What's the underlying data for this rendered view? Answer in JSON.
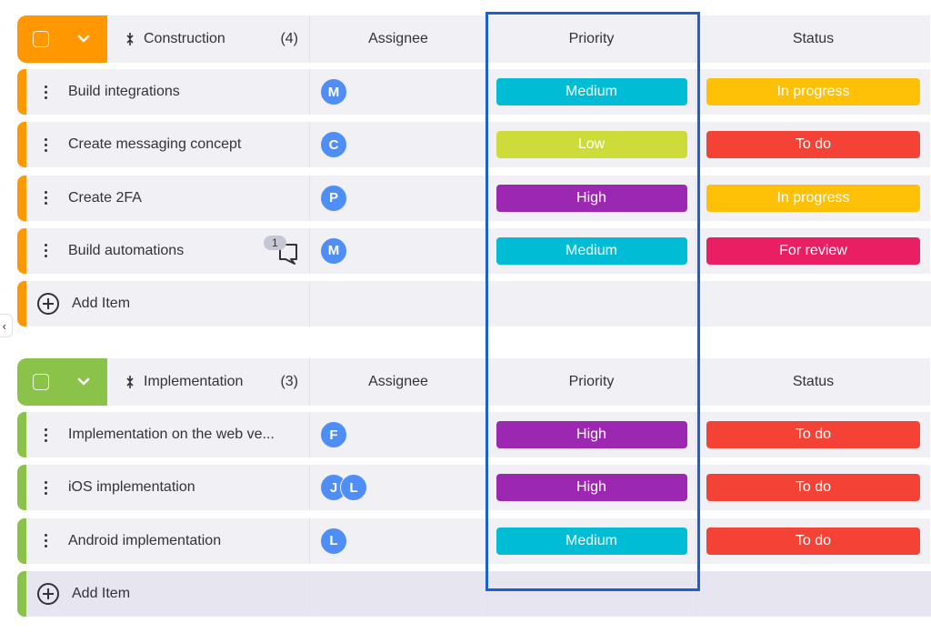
{
  "columns": {
    "assignee": "Assignee",
    "priority": "Priority",
    "status": "Status"
  },
  "colors": {
    "construction": "#ff9800",
    "implementation": "#8bc34a",
    "priority": {
      "Low": "#cddc39",
      "Medium": "#00bcd4",
      "High": "#9c27b0"
    },
    "status": {
      "In progress": "#ffc107",
      "To do": "#f44336",
      "For review": "#e91e63"
    },
    "highlight": "#1a5fd6",
    "avatar": "#4f8ef7"
  },
  "groups": [
    {
      "name": "Construction",
      "count": "(4)",
      "items": [
        {
          "name": "Build integrations",
          "assignees": [
            "M"
          ],
          "priority": "Medium",
          "status": "In progress"
        },
        {
          "name": "Create messaging concept",
          "assignees": [
            "C"
          ],
          "priority": "Low",
          "status": "To do"
        },
        {
          "name": "Create 2FA",
          "assignees": [
            "P"
          ],
          "priority": "High",
          "status": "In progress"
        },
        {
          "name": "Build automations",
          "assignees": [
            "M"
          ],
          "priority": "Medium",
          "status": "For review",
          "comments": "1"
        }
      ],
      "add_label": "Add Item"
    },
    {
      "name": "Implementation",
      "count": "(3)",
      "items": [
        {
          "name": "Implementation on the web ve...",
          "assignees": [
            "F"
          ],
          "priority": "High",
          "status": "To do"
        },
        {
          "name": "iOS implementation",
          "assignees": [
            "J",
            "L"
          ],
          "priority": "High",
          "status": "To do"
        },
        {
          "name": "Android implementation",
          "assignees": [
            "L"
          ],
          "priority": "Medium",
          "status": "To do"
        }
      ],
      "add_label": "Add Item"
    }
  ],
  "icons": {
    "checkbox": "checkbox-icon",
    "chevron": "chevron-down-icon",
    "sort": "sort-icon",
    "drag": "more-vertical-icon",
    "comment": "comment-icon",
    "add": "plus-circle-icon",
    "collapse": "chevron-left-icon"
  },
  "side_handle_glyph": "‹"
}
